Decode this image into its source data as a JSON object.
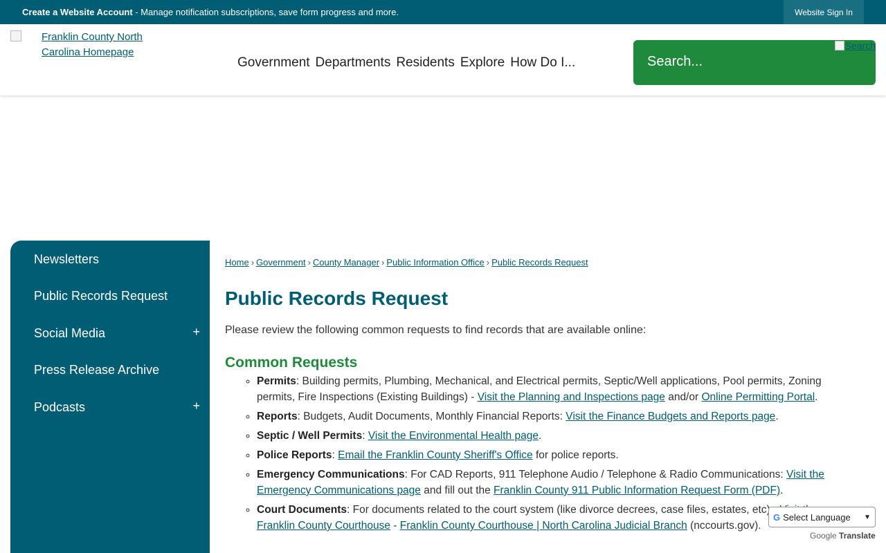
{
  "topbar": {
    "create_label": "Create a Website Account",
    "create_desc": " - Manage notification subscriptions, save form progress and more.",
    "signin_label": "Website Sign In"
  },
  "header": {
    "logo_text": "Franklin County North Carolina Homepage",
    "nav": [
      "Government",
      "Departments",
      "Residents",
      "Explore",
      "How Do I..."
    ],
    "search_placeholder": "Search...",
    "search_button": "Search"
  },
  "sidebar": {
    "items": [
      {
        "label": "Newsletters",
        "toggle": ""
      },
      {
        "label": "Public Records Request",
        "toggle": ""
      },
      {
        "label": "Social Media",
        "toggle": "+"
      },
      {
        "label": "Press Release Archive",
        "toggle": ""
      },
      {
        "label": "Podcasts",
        "toggle": "+"
      }
    ]
  },
  "breadcrumb": [
    "Home",
    "Government",
    "County Manager",
    "Public Information Office",
    "Public Records Request"
  ],
  "page": {
    "title": "Public Records Request",
    "intro": "Please review the following common requests to find records that are available online:",
    "subtitle": "Common Requests"
  },
  "requests": [
    {
      "label": "Permits",
      "text": ": Building permits, Plumbing, Mechanical, and Electrical permits, Septic/Well applications, Pool permits, Zoning permits, Fire Inspections (Existing Buildings) - ",
      "link1": "Visit the Planning and Inspections page",
      "mid": " and/or ",
      "link2": "Online Permitting Portal",
      "end": "."
    },
    {
      "label": "Reports",
      "text": ": Budgets, Audit Documents, Monthly Financial Reports: ",
      "link1": "Visit the Finance Budgets and Reports page",
      "end": "."
    },
    {
      "label": "Septic / Well Permits",
      "text": ": ",
      "link1": "Visit the Environmental Health page",
      "end": "."
    },
    {
      "label": "Police Reports",
      "text": ": ",
      "link1": "Email the Franklin County Sheriff's Office",
      "end": " for police reports."
    },
    {
      "label": "Emergency Communications",
      "text": ": For CAD Reports, 911 Telephone Audio / Telephone & Radio Communications: ",
      "link1": "Visit the Emergency Communications page",
      "mid": " and fill out the ",
      "link2": "Franklin County 911 Public Information Request Form (PDF)",
      "end": "."
    },
    {
      "label": "Court Documents",
      "text": ": For documents related to the court system (like divorce decrees, case files, estates, etc) - ",
      "link1": "Visit the Franklin County Courthouse",
      "mid": " - ",
      "link2": "Franklin County Courthouse | North Carolina Judicial Branch",
      "end": " (nccourts.gov)."
    }
  ],
  "translate": {
    "select_label": "Select Language",
    "powered_by": "Google",
    "translate_label": "Translate"
  }
}
